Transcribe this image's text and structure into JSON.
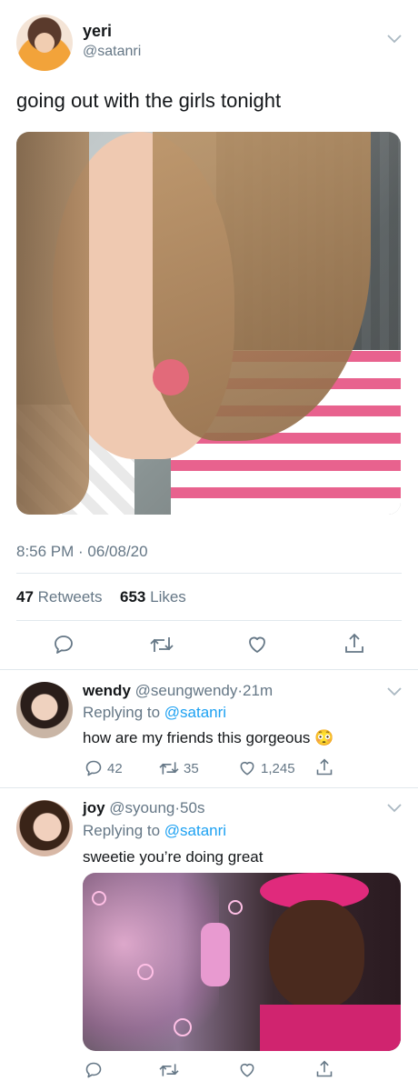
{
  "main_tweet": {
    "display_name": "yeri",
    "handle": "@satanri",
    "text": "going out with the girls tonight",
    "timestamp": "8:56 PM · 06/08/20",
    "retweet_count": "47",
    "retweet_label": "Retweets",
    "like_count": "653",
    "like_label": "Likes"
  },
  "replies": [
    {
      "display_name": "wendy",
      "handle": "@seungwendy",
      "separator": "·",
      "time": "21m",
      "replying_prefix": "Replying to",
      "replying_handle": "@satanri",
      "text": "how are my friends this gorgeous",
      "emoji": "😳",
      "reply_count": "42",
      "retweet_count": "35",
      "like_count": "1,245"
    },
    {
      "display_name": "joy",
      "handle": "@syoung",
      "separator": "·",
      "time": "50s",
      "replying_prefix": "Replying to",
      "replying_handle": "@satanri",
      "text": "sweetie you’re doing great"
    }
  ],
  "colors": {
    "accent": "#1da1f2",
    "muted": "#657786",
    "divider": "#e1e8ed"
  }
}
